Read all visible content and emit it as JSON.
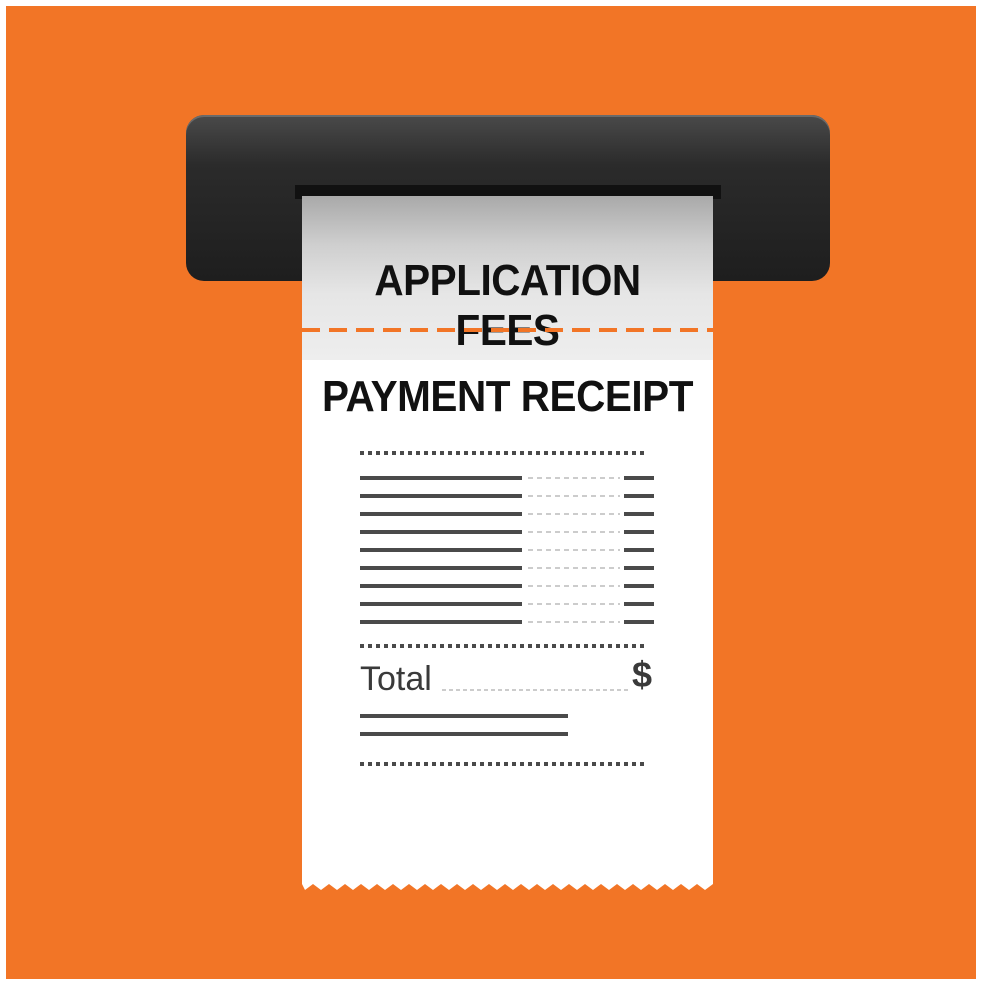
{
  "colors": {
    "background": "#F27526",
    "frame": "#ffffff",
    "slot": "#2b2b2b",
    "paper": "#ffffff",
    "ink": "#111111",
    "line": "#4a4a4a",
    "perforation": "#F27526"
  },
  "stub": {
    "title": "APPLICATION FEES"
  },
  "receipt": {
    "title": "PAYMENT RECEIPT",
    "item_rows": 9,
    "total_label": "Total",
    "total_currency": "$"
  },
  "icons": [
    "printer-slot-icon",
    "receipt-icon"
  ]
}
